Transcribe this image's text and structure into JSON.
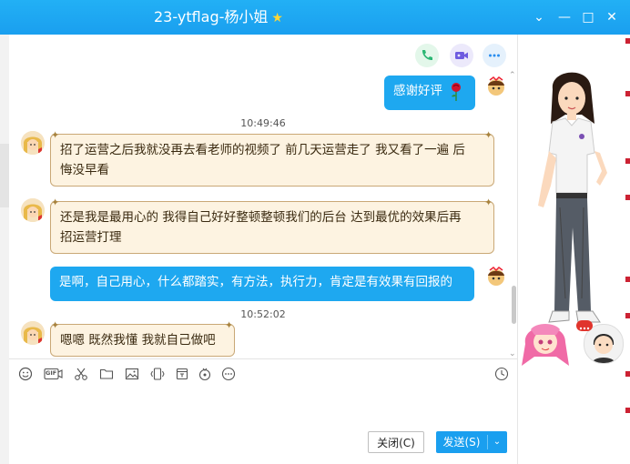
{
  "window": {
    "title": "23-ytflag-杨小姐",
    "title_star": "★",
    "minimize_glyph": "—",
    "maximize_glyph": "□",
    "close_glyph": "✕",
    "collapse_glyph": "⌄"
  },
  "chat": {
    "messages": [
      {
        "direction": "out",
        "text": "感谢好评"
      },
      {
        "direction": "time",
        "text": "10:49:46"
      },
      {
        "direction": "in",
        "lines": [
          "招了运营之后我就没再去看老师的视频了 前几天运营走了 我又看了一遍 后",
          "悔没早看"
        ]
      },
      {
        "direction": "in",
        "lines": [
          "还是我是最用心的 我得自己好好整顿整顿我们的后台 达到最优的效果后再",
          "招运营打理"
        ]
      },
      {
        "direction": "out",
        "text": "是啊，自己用心，什么都踏实，有方法，执行力，肯定是有效果有回报的"
      },
      {
        "direction": "time",
        "text": "10:52:02"
      },
      {
        "direction": "in",
        "lines": [
          "嗯嗯 既然我懂 我就自己做吧"
        ]
      }
    ]
  },
  "toolbar": {
    "icons": [
      "emoji-icon",
      "gif-icon",
      "scissors-icon",
      "folder-icon",
      "image-icon",
      "shake-icon",
      "calendar-icon",
      "red-packet-icon",
      "more-icon",
      "history-clock-icon"
    ],
    "gif_label": "GIF"
  },
  "buttons": {
    "close_label": "关闭(C)",
    "send_label": "发送(S)",
    "send_dropdown": "⌄"
  },
  "colors": {
    "title_bar": "#1a9fef",
    "outgoing_bubble": "#1ea8f0",
    "incoming_bubble": "#fdf3e1",
    "incoming_border": "#c9a876"
  }
}
